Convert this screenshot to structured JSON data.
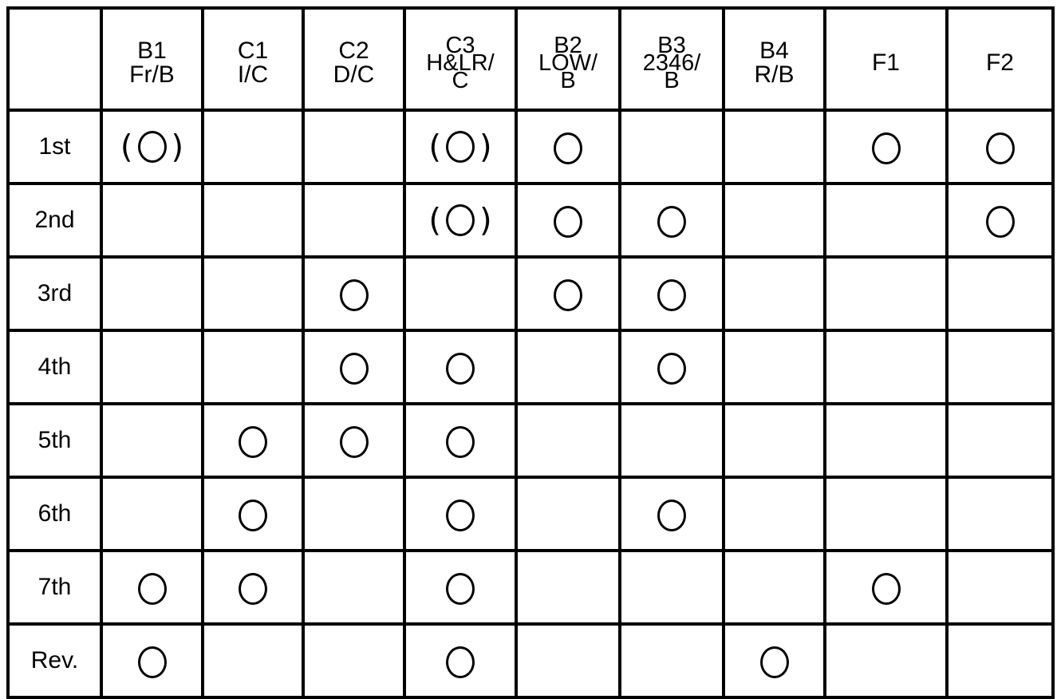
{
  "table": {
    "corner_label": "",
    "columns": [
      {
        "code": "B1",
        "name": "Fr/B"
      },
      {
        "code": "C1",
        "name": "I/C"
      },
      {
        "code": "C2",
        "name": "D/C"
      },
      {
        "code": "C3",
        "name": "H&LR/",
        "name2": "C"
      },
      {
        "code": "B2",
        "name": "LOW/",
        "name2": "B"
      },
      {
        "code": "B3",
        "name": "2346/",
        "name2": "B"
      },
      {
        "code": "B4",
        "name": "R/B"
      },
      {
        "code": "F1",
        "name": ""
      },
      {
        "code": "F2",
        "name": ""
      }
    ],
    "marks": {
      "engaged": "○",
      "conditional": "(○)",
      "none": ""
    },
    "rows": [
      {
        "label": "1st",
        "cells": [
          "(○)",
          "",
          "",
          "(○)",
          "○",
          "",
          "",
          "○",
          "○"
        ]
      },
      {
        "label": "2nd",
        "cells": [
          "",
          "",
          "",
          "(○)",
          "○",
          "○",
          "",
          "",
          "○"
        ]
      },
      {
        "label": "3rd",
        "cells": [
          "",
          "",
          "○",
          "",
          "○",
          "○",
          "",
          "",
          ""
        ]
      },
      {
        "label": "4th",
        "cells": [
          "",
          "",
          "○",
          "○",
          "",
          "○",
          "",
          "",
          ""
        ]
      },
      {
        "label": "5th",
        "cells": [
          "",
          "○",
          "○",
          "○",
          "",
          "",
          "",
          "",
          ""
        ]
      },
      {
        "label": "6th",
        "cells": [
          "",
          "○",
          "",
          "○",
          "",
          "○",
          "",
          "",
          ""
        ]
      },
      {
        "label": "7th",
        "cells": [
          "○",
          "○",
          "",
          "○",
          "",
          "",
          "",
          "○",
          ""
        ]
      },
      {
        "label": "Rev.",
        "cells": [
          "○",
          "",
          "",
          "○",
          "",
          "",
          "○",
          "",
          ""
        ]
      }
    ]
  }
}
